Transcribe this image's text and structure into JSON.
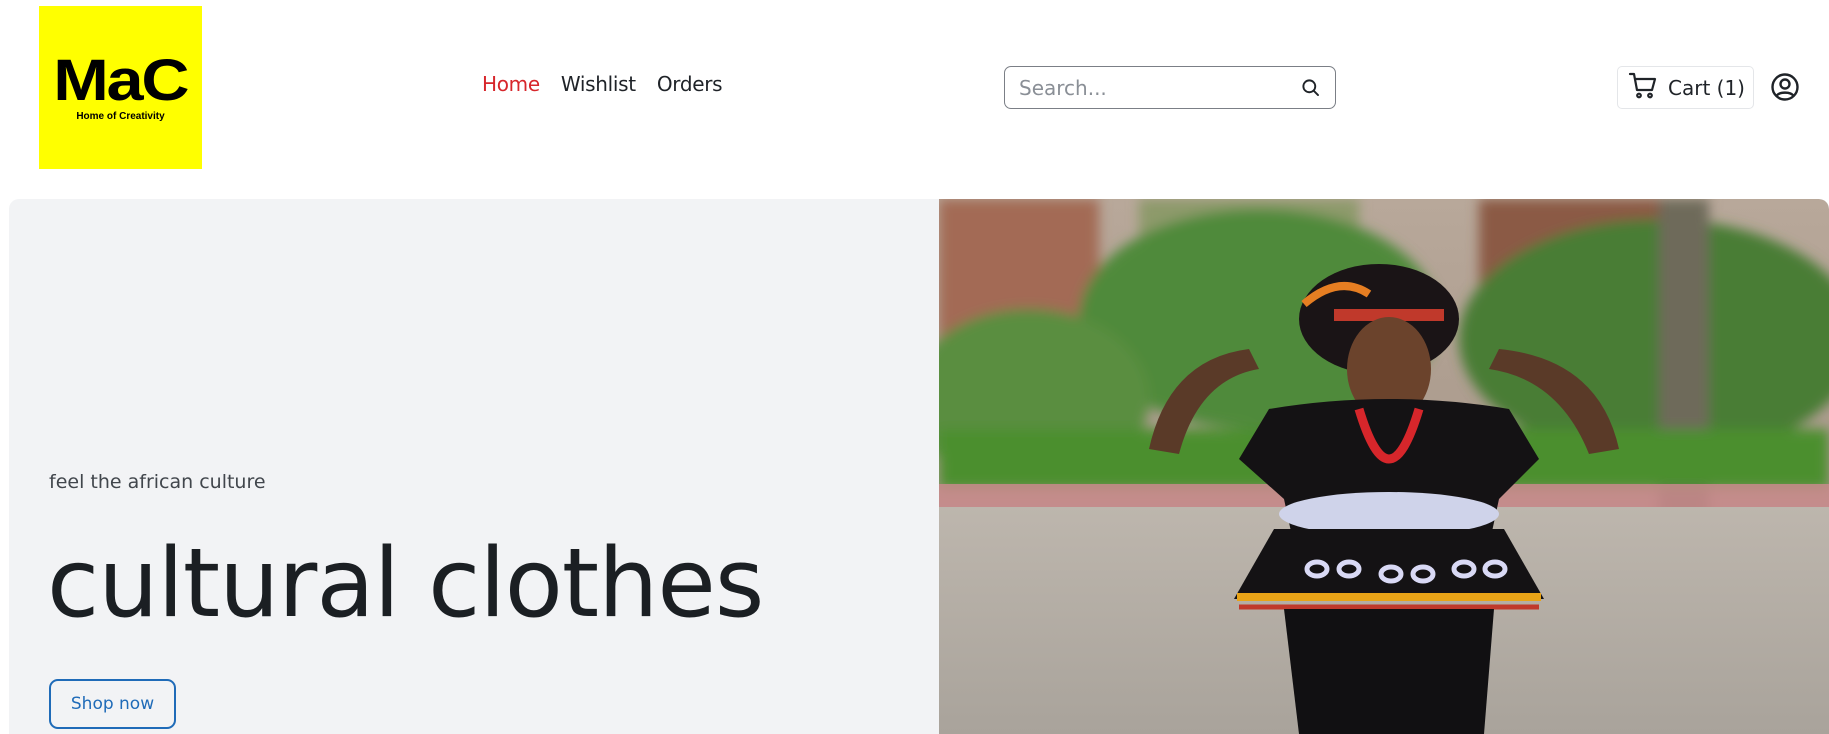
{
  "brand": {
    "logo_text": "MaC",
    "tagline": "Home of Creativity",
    "logo_color": "#ffff00"
  },
  "nav": {
    "items": [
      {
        "label": "Home",
        "active": true
      },
      {
        "label": "Wishlist",
        "active": false
      },
      {
        "label": "Orders",
        "active": false
      }
    ],
    "active_color": "#d7262b"
  },
  "search": {
    "placeholder": "Search...",
    "value": "",
    "icon": "search-icon"
  },
  "cart": {
    "label": "Cart (1)",
    "icon": "cart-icon"
  },
  "account": {
    "icon": "user-circle-icon"
  },
  "hero": {
    "subtitle": "feel the african culture",
    "title": "cultural clothes",
    "cta_label": "Shop now",
    "cta_color": "#1f6bb8",
    "background": "#f2f3f5"
  }
}
